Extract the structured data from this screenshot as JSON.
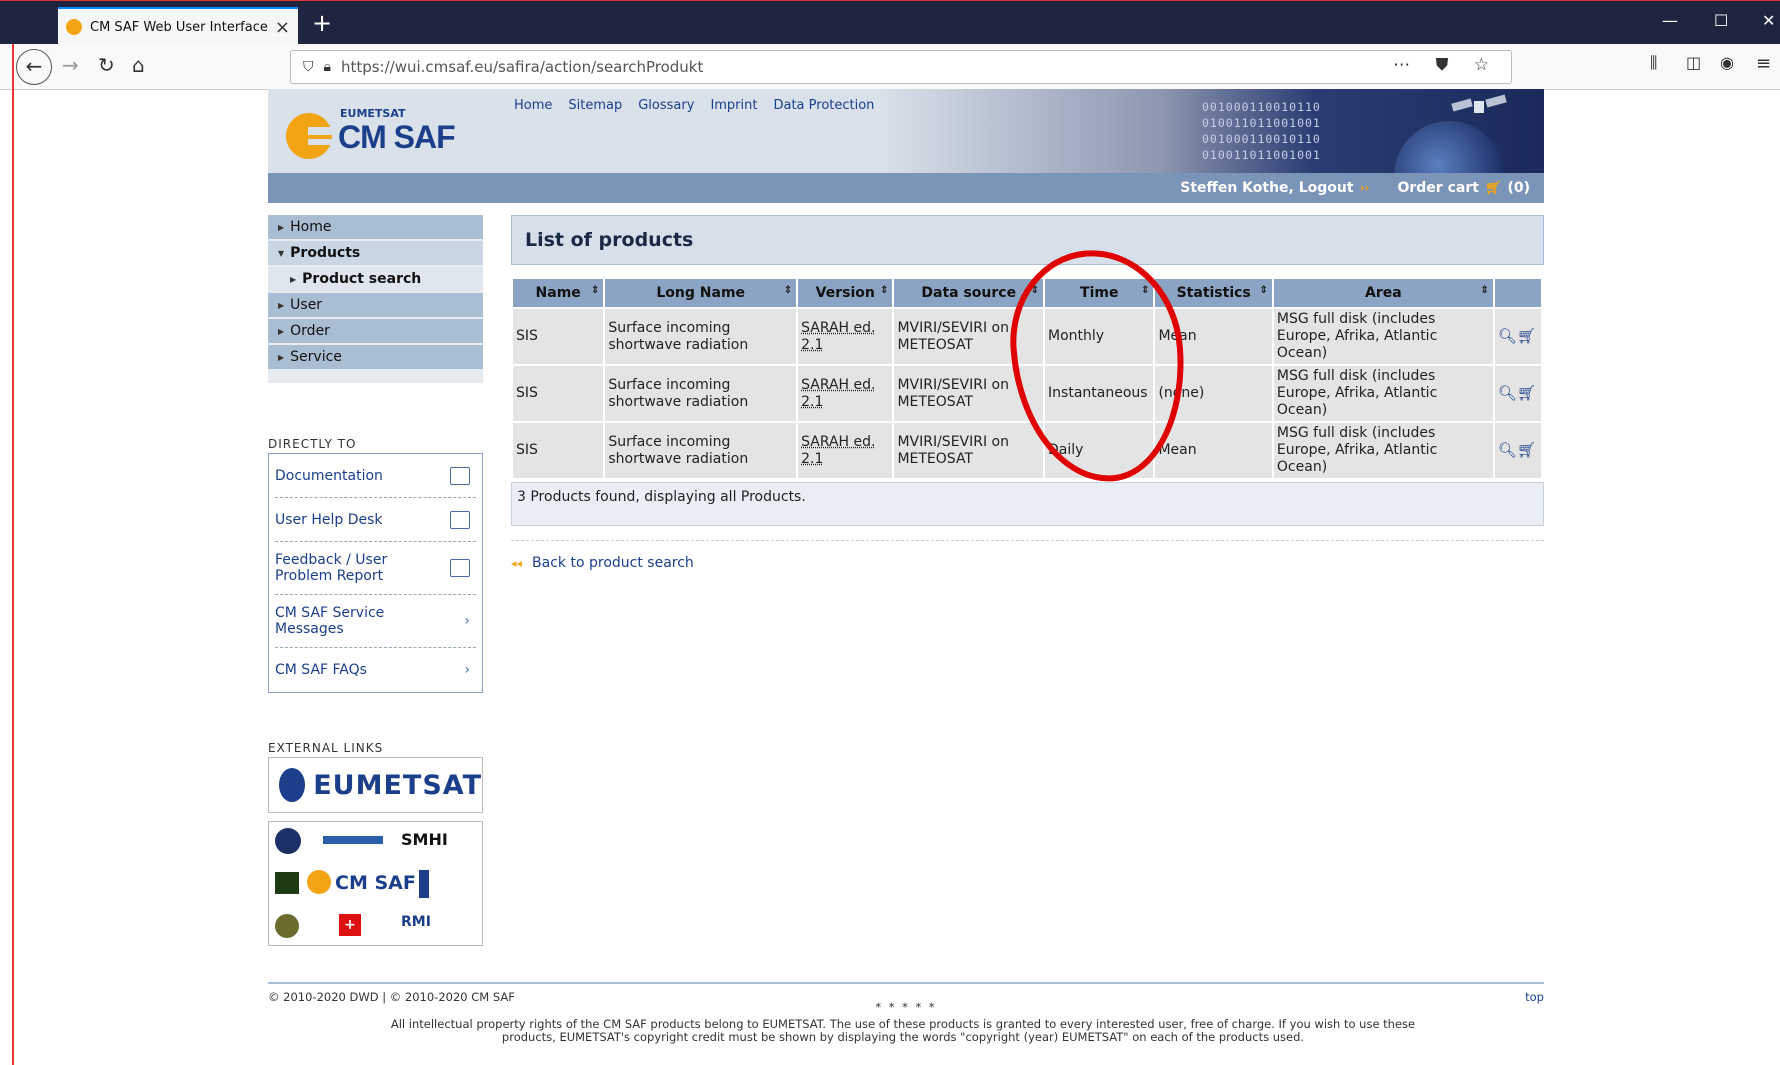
{
  "browser": {
    "tab_title": "CM SAF Web User Interface // P",
    "url": "https://wui.cmsaf.eu/safira/action/searchProdukt"
  },
  "header": {
    "logo_small": "EUMETSAT",
    "logo_big": "CM SAF",
    "nav": [
      "Home",
      "Sitemap",
      "Glossary",
      "Imprint",
      "Data Protection"
    ],
    "binary": [
      "001000110010110",
      "010011011001001",
      "001000110010110",
      "010011011001001"
    ],
    "user_link": "Steffen Kothe, Logout",
    "cart_label": "Order cart",
    "cart_count": "(0)"
  },
  "sidebar": {
    "menu": [
      {
        "label": "Home"
      },
      {
        "label": "Products"
      },
      {
        "label": "Product search"
      },
      {
        "label": "User"
      },
      {
        "label": "Order"
      },
      {
        "label": "Service"
      }
    ],
    "directly_title": "DIRECTLY TO",
    "directly": [
      {
        "label": "Documentation"
      },
      {
        "label": "User Help Desk"
      },
      {
        "label": "Feedback / User Problem Report"
      },
      {
        "label": "CM SAF Service Messages"
      },
      {
        "label": "CM SAF FAQs"
      }
    ],
    "external_title": "EXTERNAL LINKS",
    "eumetsat_logo": "EUMETSAT",
    "partners": {
      "smhi": "SMHI",
      "cmsaf": "CM SAF",
      "rmi": "RMI"
    }
  },
  "main": {
    "title": "List of products",
    "columns": [
      "Name",
      "Long Name",
      "Version",
      "Data source",
      "Time",
      "Statistics",
      "Area",
      ""
    ],
    "rows": [
      {
        "name": "SIS",
        "long_name": "Surface incoming shortwave radiation",
        "version": "SARAH ed. 2.1",
        "source": "MVIRI/SEVIRI on METEOSAT",
        "time": "Monthly",
        "stat": "Mean",
        "area": "MSG full disk (includes Europe, Afrika, Atlantic Ocean)"
      },
      {
        "name": "SIS",
        "long_name": "Surface incoming shortwave radiation",
        "version": "SARAH ed. 2.1",
        "source": "MVIRI/SEVIRI on METEOSAT",
        "time": "Instantaneous",
        "stat": "(none)",
        "area": "MSG full disk (includes Europe, Afrika, Atlantic Ocean)"
      },
      {
        "name": "SIS",
        "long_name": "Surface incoming shortwave radiation",
        "version": "SARAH ed. 2.1",
        "source": "MVIRI/SEVIRI on METEOSAT",
        "time": "Daily",
        "stat": "Mean",
        "area": "MSG full disk (includes Europe, Afrika, Atlantic Ocean)"
      }
    ],
    "found_text": "3 Products found, displaying all Products.",
    "back_link": "Back to product search"
  },
  "footer": {
    "copyright": "© 2010-2020 DWD | © 2010-2020 CM SAF",
    "top": "top",
    "stars": "* * * * *",
    "rights": "All intellectual property rights of the CM SAF products belong to EUMETSAT. The use of these products is granted to every interested user, free of charge. If you wish to use these products, EUMETSAT's copyright credit must be shown by displaying the words \"copyright (year) EUMETSAT\" on each of the products used."
  },
  "colors": {
    "accent": "#1b3f8b",
    "orange": "#f2a413",
    "annotation": "#e00000"
  }
}
